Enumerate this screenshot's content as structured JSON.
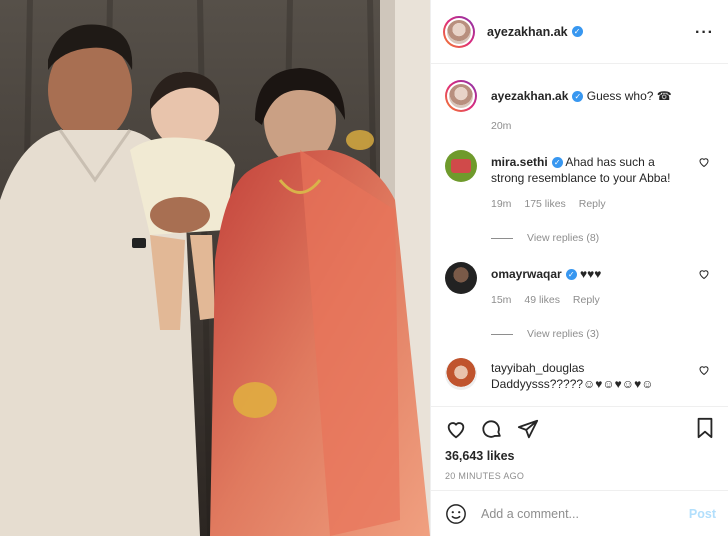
{
  "header": {
    "username": "ayezakhan.ak",
    "more_icon": "more-horizontal-icon"
  },
  "caption": {
    "username": "ayezakhan.ak",
    "text": "Guess who? ☎",
    "time": "20m"
  },
  "comments": [
    {
      "username": "mira.sethi",
      "verified": true,
      "text": "Ahad has such a strong resemblance to your Abba!",
      "time": "19m",
      "likes": "175 likes",
      "reply": "Reply",
      "view_replies": "View replies (8)"
    },
    {
      "username": "omayrwaqar",
      "verified": true,
      "text": "♥♥♥",
      "time": "15m",
      "likes": "49 likes",
      "reply": "Reply",
      "view_replies": "View replies (3)"
    },
    {
      "username": "tayyibah_douglas",
      "verified": false,
      "text": "Daddyysss?????☺♥☺♥☺♥☺"
    }
  ],
  "stats": {
    "likes": "36,643 likes",
    "posted": "20 MINUTES AGO"
  },
  "add_comment": {
    "placeholder": "Add a comment...",
    "post_label": "Post"
  },
  "colors": {
    "verified": "#3897f0",
    "post_disabled": "#b2dffc",
    "muted": "#8e8e8e"
  }
}
